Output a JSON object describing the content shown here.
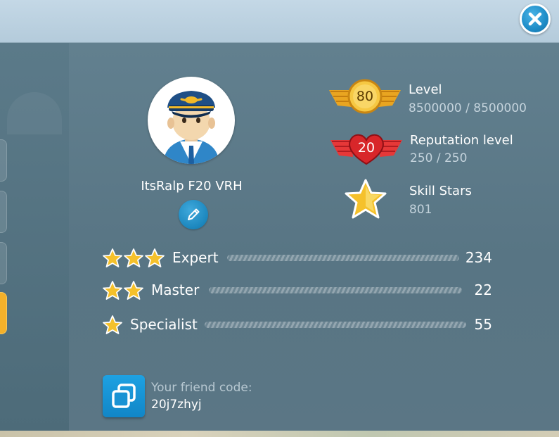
{
  "profile": {
    "player_name": "ItsRalp F20 VRH",
    "avatar_icon": "pilot-avatar-icon"
  },
  "stats": {
    "level": {
      "badge": "80",
      "label": "Level",
      "value": "8500000 / 8500000"
    },
    "reputation": {
      "badge": "20",
      "label": "Reputation level",
      "value": "250 / 250"
    },
    "skill_stars": {
      "label": "Skill Stars",
      "value": "801"
    }
  },
  "skills": [
    {
      "stars": 3,
      "label": "Expert",
      "count": "234"
    },
    {
      "stars": 2,
      "label": "Master",
      "count": "22"
    },
    {
      "stars": 1,
      "label": "Specialist",
      "count": "55"
    }
  ],
  "friend": {
    "label": "Your friend code:",
    "code": "20j7zhyj"
  },
  "colors": {
    "accent_blue": "#1d8cc7",
    "gold": "#f3b52a",
    "red_badge": "#d8262a",
    "active_tab": "#f4b12a"
  }
}
